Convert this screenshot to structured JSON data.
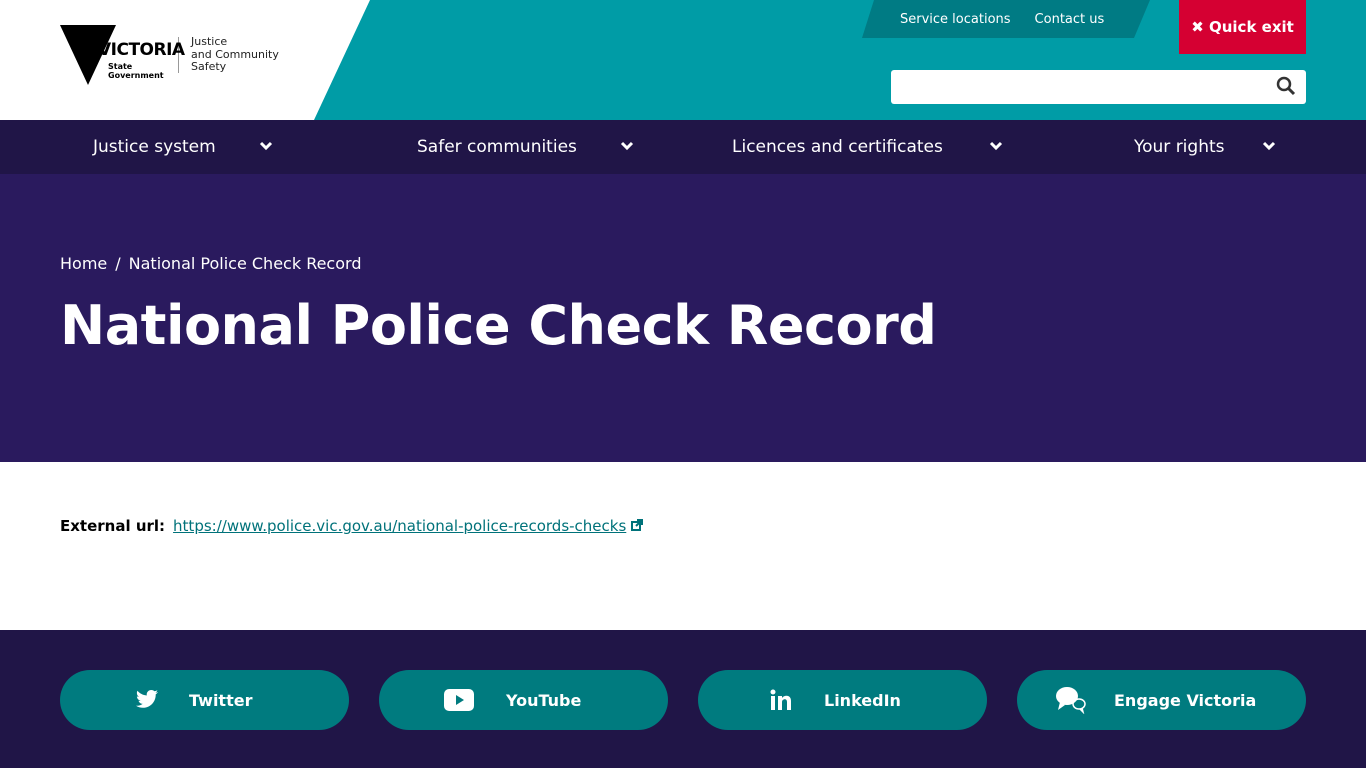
{
  "header": {
    "logo_word": "VICTORIA",
    "logo_sub1": "State",
    "logo_sub2": "Government",
    "dept_line1": "Justice",
    "dept_line2": "and Community",
    "dept_line3": "Safety",
    "top_links": [
      "Service locations",
      "Contact us"
    ],
    "quick_exit": "✖ Quick exit",
    "search_placeholder": "",
    "colors": {
      "teal": "#009ca6",
      "quick_exit": "#d50032"
    }
  },
  "nav": {
    "items": [
      {
        "label": "Justice system"
      },
      {
        "label": "Safer communities"
      },
      {
        "label": "Licences and certificates"
      },
      {
        "label": "Your rights"
      }
    ]
  },
  "hero": {
    "breadcrumb": [
      "Home",
      "/",
      "National Police Check Record"
    ],
    "title": "National Police Check Record"
  },
  "content": {
    "external_label": "External url:",
    "external_url": "https://www.police.vic.gov.au/national-police-records-checks"
  },
  "footer": {
    "social": [
      {
        "label": "Twitter",
        "icon": "twitter-icon"
      },
      {
        "label": "YouTube",
        "icon": "youtube-icon"
      },
      {
        "label": "LinkedIn",
        "icon": "linkedin-icon"
      },
      {
        "label": "Engage Victoria",
        "icon": "chat-icon"
      }
    ]
  }
}
